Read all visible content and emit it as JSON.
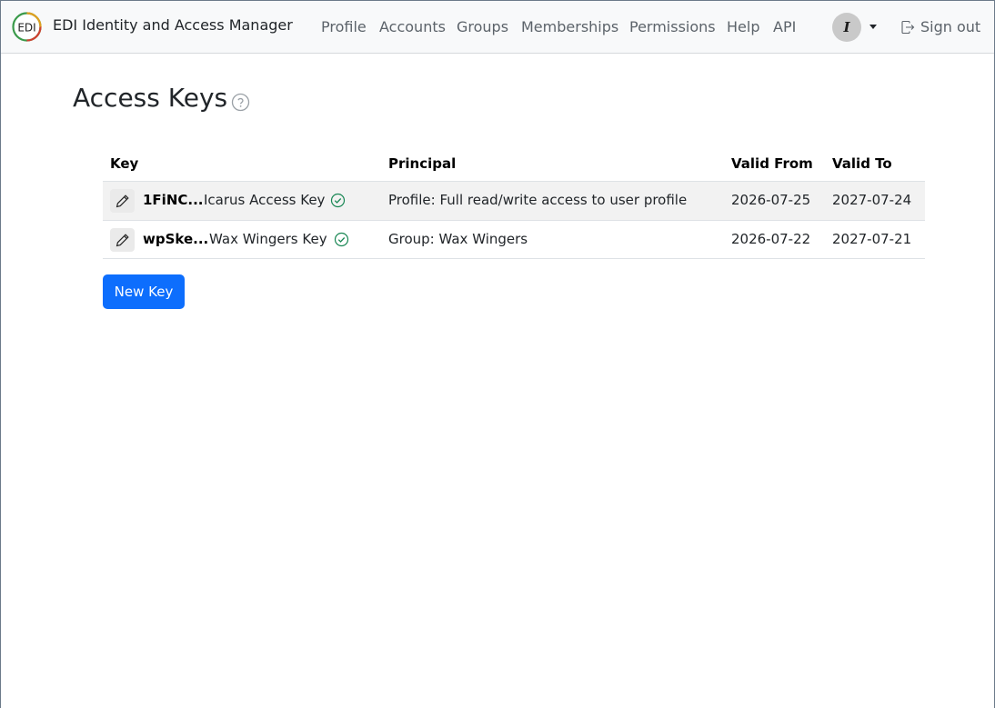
{
  "app": {
    "title": "EDI Identity and Access Manager",
    "logo_text": "EDI"
  },
  "nav": {
    "items": [
      {
        "label": "Profile"
      },
      {
        "label": "Accounts"
      },
      {
        "label": "Groups"
      },
      {
        "label": "Memberships"
      },
      {
        "label": "Permissions"
      },
      {
        "label": "Help"
      },
      {
        "label": "API"
      }
    ],
    "avatar_initial": "I",
    "signout_label": "Sign out"
  },
  "page": {
    "title": "Access Keys"
  },
  "table": {
    "headers": {
      "key": "Key",
      "principal": "Principal",
      "valid_from": "Valid From",
      "valid_to": "Valid To"
    },
    "rows": [
      {
        "key_id": "1FiNC...",
        "key_name": "Icarus Access Key",
        "principal": "Profile: Full read/write access to user profile",
        "valid_from": "2026-07-25",
        "valid_to": "2027-07-24"
      },
      {
        "key_id": "wpSke...",
        "key_name": "Wax Wingers Key",
        "principal": "Group: Wax Wingers",
        "valid_from": "2026-07-22",
        "valid_to": "2027-07-21"
      }
    ]
  },
  "actions": {
    "new_key_label": "New Key"
  },
  "colors": {
    "primary": "#0d6efd",
    "success": "#198754",
    "navbar_bg": "#f8f9fa"
  }
}
